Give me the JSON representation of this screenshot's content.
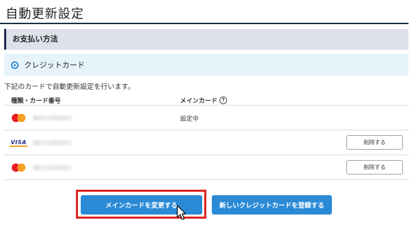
{
  "page": {
    "title": "自動更新設定"
  },
  "section": {
    "title": "お支払い方法"
  },
  "payment_method": {
    "label": "クレジットカード",
    "selected": true
  },
  "description": "下記のカードで自動更新設定を行います。",
  "table": {
    "headers": {
      "type": "種類・カード番号",
      "main_card": "メインカード"
    }
  },
  "cards": [
    {
      "brand": "mastercard-icon",
      "status": "設定中",
      "delete_label": ""
    },
    {
      "brand": "visa-icon",
      "brand_text": "VISA",
      "status": "",
      "delete_label": "削除する"
    },
    {
      "brand": "mastercard-icon",
      "status": "",
      "delete_label": "削除する"
    }
  ],
  "actions": {
    "change_main": "メインカードを変更する",
    "add_new": "新しいクレジットカードを登録する"
  },
  "colors": {
    "accent": "#2a8ad6",
    "navy": "#1b2b4a",
    "highlight": "#e0231f"
  }
}
